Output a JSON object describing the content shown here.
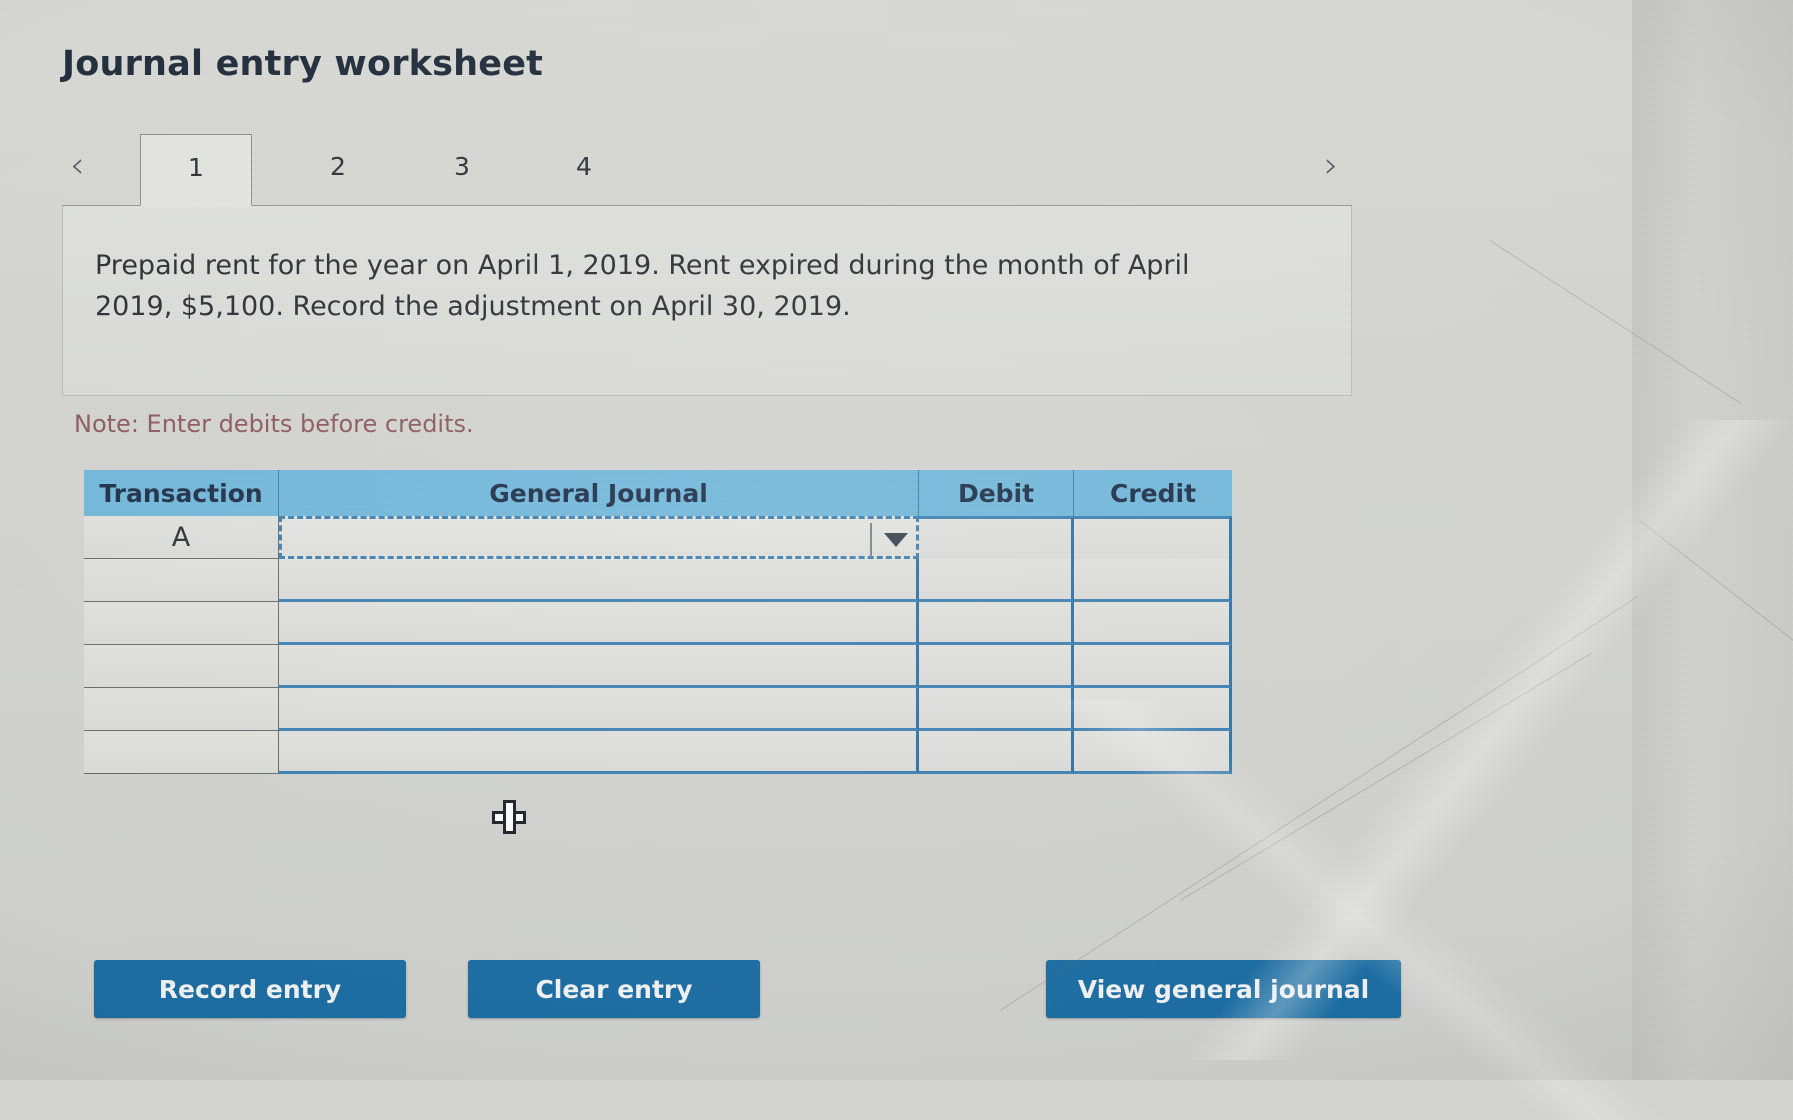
{
  "page": {
    "title": "Journal entry worksheet",
    "note": "Note: Enter debits before credits.",
    "description": "Prepaid rent for the year on April 1, 2019. Rent expired during the month of April 2019, $5,100. Record the adjustment on April 30, 2019."
  },
  "nav": {
    "prev_icon": "‹",
    "next_icon": "›",
    "tabs": [
      {
        "label": "1",
        "active": true
      },
      {
        "label": "2",
        "active": false
      },
      {
        "label": "3",
        "active": false
      },
      {
        "label": "4",
        "active": false
      }
    ]
  },
  "table": {
    "columns": [
      "Transaction",
      "General Journal",
      "Debit",
      "Credit"
    ],
    "rows": [
      {
        "transaction": "A",
        "general_journal": "",
        "debit": "",
        "credit": "",
        "selected": true
      },
      {
        "transaction": "",
        "general_journal": "",
        "debit": "",
        "credit": "",
        "selected": false
      },
      {
        "transaction": "",
        "general_journal": "",
        "debit": "",
        "credit": "",
        "selected": false
      },
      {
        "transaction": "",
        "general_journal": "",
        "debit": "",
        "credit": "",
        "selected": false
      },
      {
        "transaction": "",
        "general_journal": "",
        "debit": "",
        "credit": "",
        "selected": false
      },
      {
        "transaction": "",
        "general_journal": "",
        "debit": "",
        "credit": "",
        "selected": false
      }
    ],
    "dropdown_icon": "▼"
  },
  "buttons": {
    "record": "Record entry",
    "clear": "Clear entry",
    "view": "View general journal"
  },
  "colors": {
    "header_blue": "#72b9dd",
    "button_blue": "#1d6fa5",
    "grid_blue": "#3f82b4",
    "note_red": "#8d5a5d",
    "title_navy": "#24303f",
    "page_grey": "#d5d6d2"
  },
  "cursor": {
    "icon": "cell-select-crosshair"
  }
}
